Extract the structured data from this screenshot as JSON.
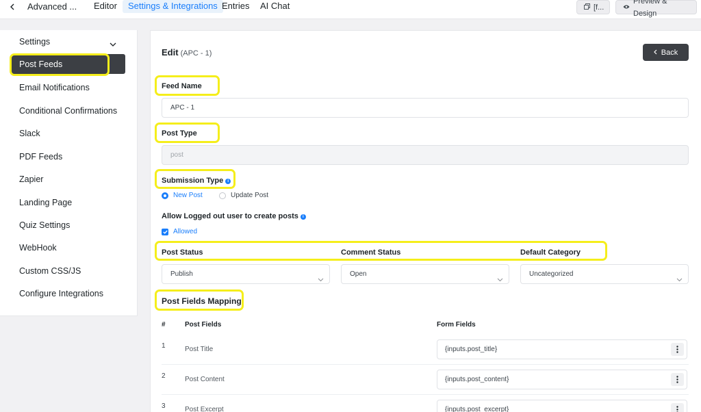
{
  "topbar": {
    "form_title": "Advanced ...",
    "tabs": [
      {
        "label": "Editor"
      },
      {
        "label": "Settings & Integrations"
      },
      {
        "label": "Entries"
      },
      {
        "label": "AI Chat"
      }
    ],
    "shortcode_label": "[f...",
    "preview_label": "Preview & Design"
  },
  "sidebar": {
    "heading": "Settings",
    "active_item": "Post Feeds",
    "items": [
      {
        "label": "Email Notifications"
      },
      {
        "label": "Conditional Confirmations"
      },
      {
        "label": "Slack"
      },
      {
        "label": "PDF Feeds"
      },
      {
        "label": "Zapier"
      },
      {
        "label": "Landing Page"
      },
      {
        "label": "Quiz Settings"
      },
      {
        "label": "WebHook"
      },
      {
        "label": "Custom CSS/JS"
      },
      {
        "label": "Configure Integrations"
      }
    ]
  },
  "main": {
    "title": "Edit",
    "subtitle": "(APC - 1)",
    "back_label": "Back",
    "feed_name": {
      "label": "Feed Name",
      "value": "APC - 1"
    },
    "post_type": {
      "label": "Post Type",
      "value": "post"
    },
    "submission_type": {
      "label": "Submission Type",
      "options": [
        {
          "label": "New Post",
          "selected": true
        },
        {
          "label": "Update Post",
          "selected": false
        }
      ]
    },
    "allow_logged_out": {
      "label": "Allow Logged out user to create posts",
      "option_label": "Allowed",
      "checked": true
    },
    "selects": [
      {
        "label": "Post Status",
        "value": "Publish"
      },
      {
        "label": "Comment Status",
        "value": "Open"
      },
      {
        "label": "Default Category",
        "value": "Uncategorized"
      }
    ],
    "mapping": {
      "title": "Post Fields Mapping",
      "headers": {
        "num": "#",
        "post_fields": "Post Fields",
        "form_fields": "Form Fields"
      },
      "rows": [
        {
          "num": "1",
          "post_field": "Post Title",
          "form_field": "{inputs.post_title}"
        },
        {
          "num": "2",
          "post_field": "Post Content",
          "form_field": "{inputs.post_content}"
        },
        {
          "num": "3",
          "post_field": "Post Excerpt",
          "form_field": "{inputs.post_excerpt}"
        }
      ]
    }
  },
  "colors": {
    "accent": "#1a7efb",
    "highlight": "#f5ee1b",
    "dark_button": "#3c3f44"
  }
}
